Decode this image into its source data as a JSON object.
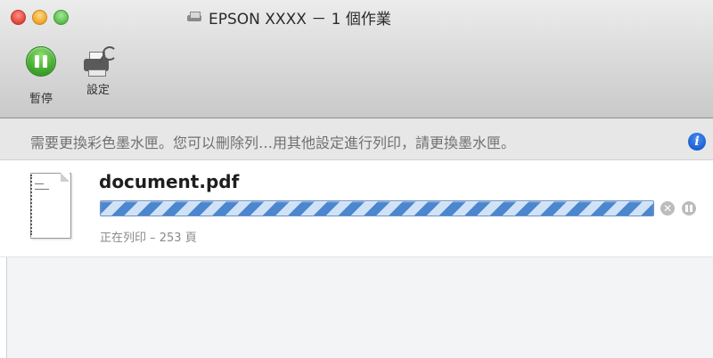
{
  "window": {
    "title": "EPSON XXXX － 1 個作業",
    "title_icon": "printer-icon"
  },
  "toolbar": {
    "pause_label": "暫停",
    "settings_label": "設定"
  },
  "message": {
    "text": "需要更換彩色墨水匣。您可以刪除列…用其他設定進行列印，請更換墨水匣。",
    "info_icon": "info-icon",
    "info_glyph": "i"
  },
  "job": {
    "filename": "document.pdf",
    "progress": 1.0,
    "status": "正在列印 – 253 頁",
    "cancel_glyph": "✕"
  },
  "colors": {
    "accent": "#4b86cf",
    "pause_green": "#3fa52d",
    "info_blue": "#1c5fd1"
  }
}
